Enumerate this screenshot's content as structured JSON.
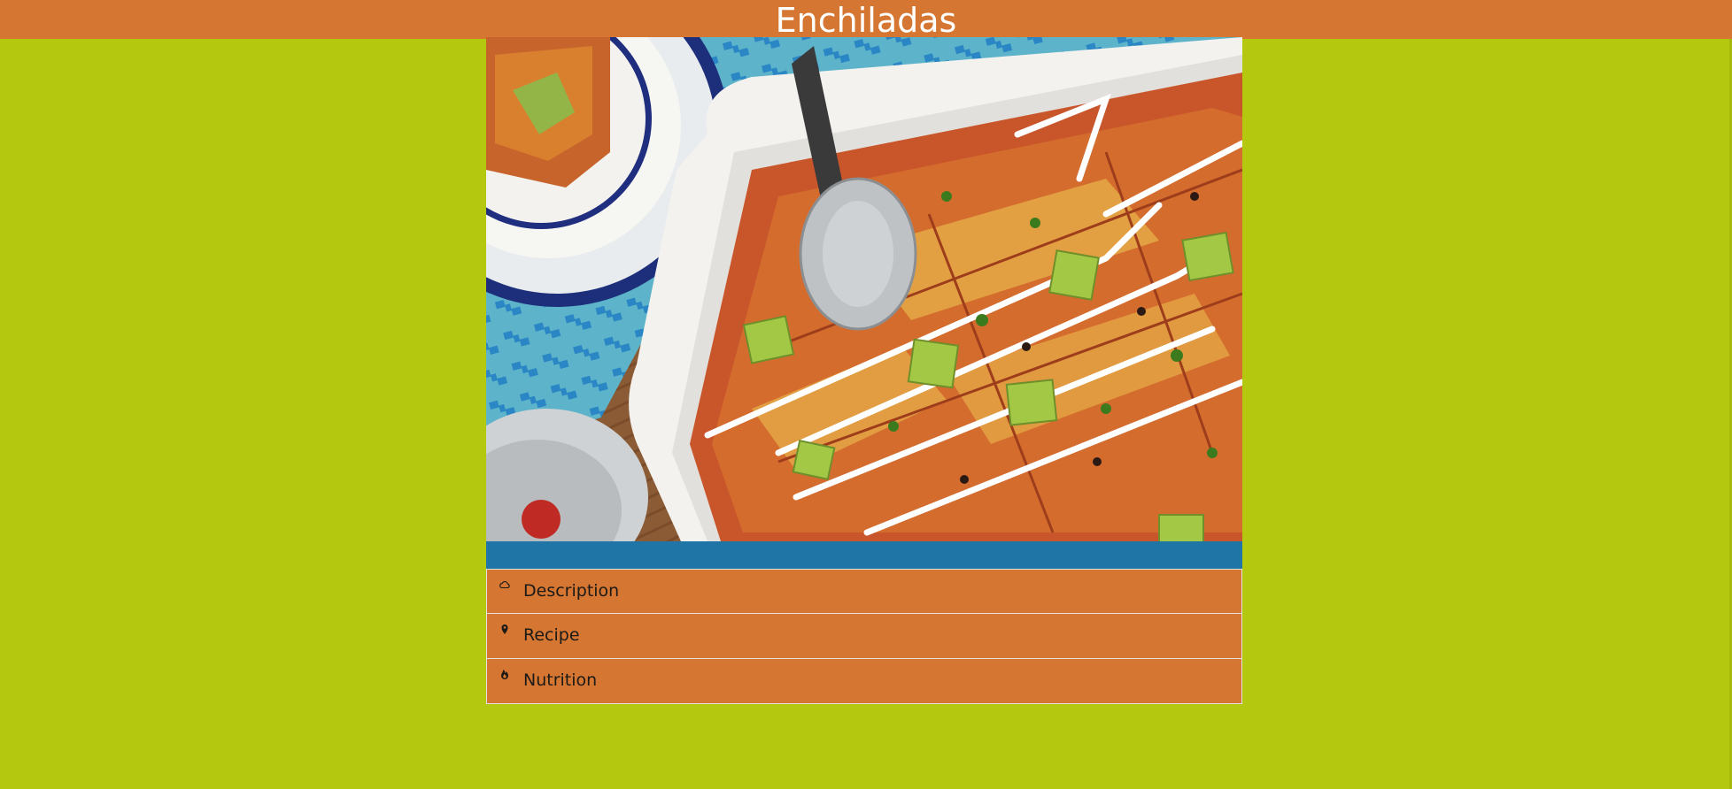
{
  "header": {
    "title": "Enchiladas",
    "background_color": "#d57632"
  },
  "hero_image": {
    "icon": "enchiladas-photo"
  },
  "accent_bar": {
    "color": "#1f76a6"
  },
  "menu": {
    "items": [
      {
        "label": "Description",
        "icon": "cloud-icon"
      },
      {
        "label": "Recipe",
        "icon": "map-pin-icon"
      },
      {
        "label": "Nutrition",
        "icon": "flame-icon"
      }
    ]
  },
  "colors": {
    "page_background": "#b3c80f",
    "menu_item_background": "#d57632",
    "title_text": "#ffffff"
  }
}
